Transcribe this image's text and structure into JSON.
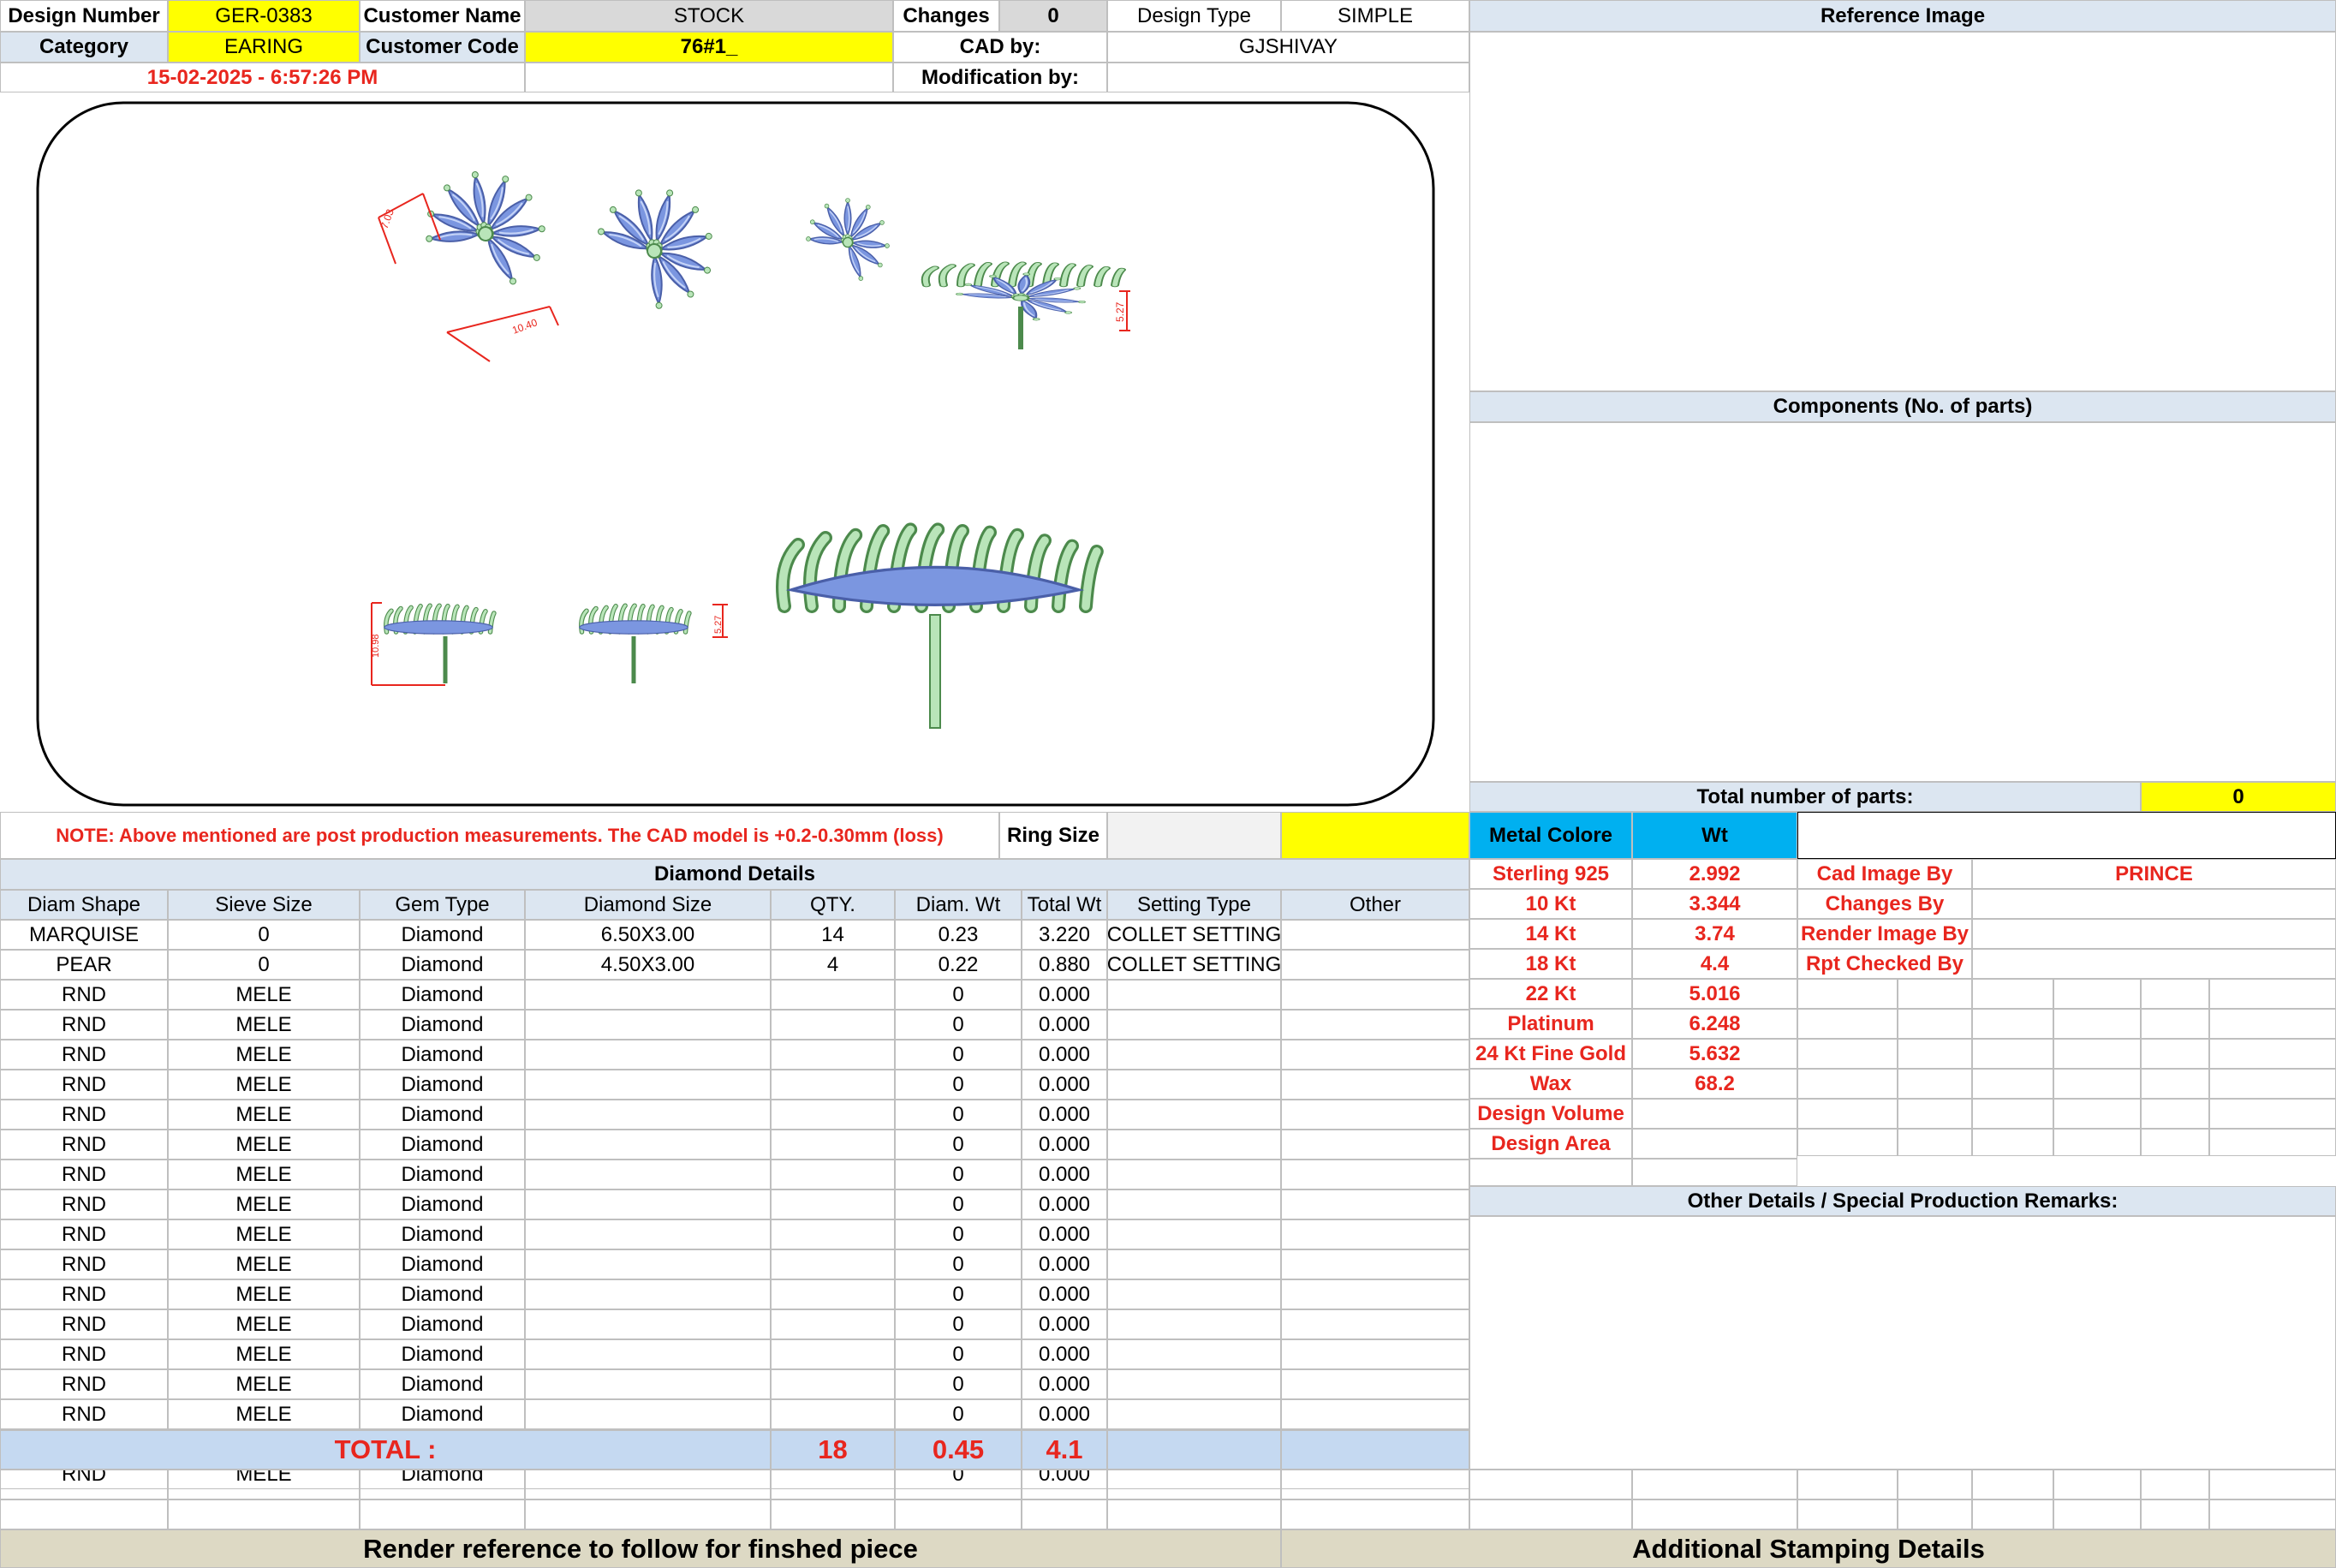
{
  "header": {
    "design_number_label": "Design Number",
    "design_number": "GER-0383",
    "customer_name_label": "Customer Name",
    "customer_name": "STOCK",
    "changes_label": "Changes",
    "changes": "0",
    "design_type_label": "Design Type",
    "design_type": "SIMPLE",
    "reference_image_label": "Reference Image",
    "category_label": "Category",
    "category": "EARING",
    "customer_code_label": "Customer Code",
    "customer_code": "76#1_",
    "cad_by_label": "CAD by:",
    "cad_by": "GJSHIVAY",
    "timestamp": "15-02-2025 - 6:57:26 PM",
    "modification_by_label": "Modification by:"
  },
  "drawing": {
    "dims": [
      "7.03",
      "10.40",
      "5.27",
      "10.98",
      "5.27"
    ]
  },
  "components": {
    "title": "Components (No. of parts)",
    "total_parts_label": "Total number of parts:",
    "total_parts": "0"
  },
  "note": "NOTE: Above mentioned are post production measurements. The CAD model is +0.2-0.30mm (loss)",
  "ring_size_label": "Ring Size",
  "metal": {
    "header": [
      "Metal Colore",
      "Wt"
    ],
    "rows": [
      [
        "Sterling 925",
        "2.992"
      ],
      [
        "10 Kt",
        "3.344"
      ],
      [
        "14 Kt",
        "3.74"
      ],
      [
        "18 Kt",
        "4.4"
      ],
      [
        "22 Kt",
        "5.016"
      ],
      [
        "Platinum",
        "6.248"
      ],
      [
        "24 Kt Fine Gold",
        "5.632"
      ],
      [
        "Wax",
        "68.2"
      ],
      [
        "Design Volume",
        ""
      ],
      [
        "Design Area",
        ""
      ]
    ]
  },
  "credits": [
    {
      "label": "Cad Image By",
      "value": "PRINCE"
    },
    {
      "label": "Changes By",
      "value": ""
    },
    {
      "label": "Render Image By",
      "value": ""
    },
    {
      "label": "Rpt Checked By",
      "value": ""
    }
  ],
  "other_details_title": "Other Details / Special Production Remarks:",
  "diamond": {
    "title": "Diamond Details",
    "columns": [
      "Diam Shape",
      "Sieve Size",
      "Gem Type",
      "Diamond Size",
      "QTY.",
      "Diam. Wt",
      "Total Wt",
      "Setting Type",
      "Other"
    ],
    "rows": [
      [
        "MARQUISE",
        "0",
        "Diamond",
        "6.50X3.00",
        "14",
        "0.23",
        "3.220",
        "COLLET SETTING",
        ""
      ],
      [
        "PEAR",
        "0",
        "Diamond",
        "4.50X3.00",
        "4",
        "0.22",
        "0.880",
        "COLLET SETTING",
        ""
      ],
      [
        "RND",
        "MELE",
        "Diamond",
        "",
        "",
        "0",
        "0.000",
        "",
        ""
      ],
      [
        "RND",
        "MELE",
        "Diamond",
        "",
        "",
        "0",
        "0.000",
        "",
        ""
      ],
      [
        "RND",
        "MELE",
        "Diamond",
        "",
        "",
        "0",
        "0.000",
        "",
        ""
      ],
      [
        "RND",
        "MELE",
        "Diamond",
        "",
        "",
        "0",
        "0.000",
        "",
        ""
      ],
      [
        "RND",
        "MELE",
        "Diamond",
        "",
        "",
        "0",
        "0.000",
        "",
        ""
      ],
      [
        "RND",
        "MELE",
        "Diamond",
        "",
        "",
        "0",
        "0.000",
        "",
        ""
      ],
      [
        "RND",
        "MELE",
        "Diamond",
        "",
        "",
        "0",
        "0.000",
        "",
        ""
      ],
      [
        "RND",
        "MELE",
        "Diamond",
        "",
        "",
        "0",
        "0.000",
        "",
        ""
      ],
      [
        "RND",
        "MELE",
        "Diamond",
        "",
        "",
        "0",
        "0.000",
        "",
        ""
      ],
      [
        "RND",
        "MELE",
        "Diamond",
        "",
        "",
        "0",
        "0.000",
        "",
        ""
      ],
      [
        "RND",
        "MELE",
        "Diamond",
        "",
        "",
        "0",
        "0.000",
        "",
        ""
      ],
      [
        "RND",
        "MELE",
        "Diamond",
        "",
        "",
        "0",
        "0.000",
        "",
        ""
      ],
      [
        "RND",
        "MELE",
        "Diamond",
        "",
        "",
        "0",
        "0.000",
        "",
        ""
      ],
      [
        "RND",
        "MELE",
        "Diamond",
        "",
        "",
        "0",
        "0.000",
        "",
        ""
      ],
      [
        "RND",
        "MELE",
        "Diamond",
        "",
        "",
        "0",
        "0.000",
        "",
        ""
      ],
      [
        "RND",
        "MELE",
        "Diamond",
        "",
        "",
        "0",
        "0.000",
        "",
        ""
      ],
      [
        "RND",
        "MELE",
        "Diamond",
        "",
        "",
        "0",
        "0.000",
        "",
        ""
      ]
    ],
    "total_label": "TOTAL :",
    "total_qty": "18",
    "total_diam_wt": "0.45",
    "total_wt": "4.1"
  },
  "footer": {
    "render_reference": "Render reference to follow for finshed piece",
    "stamping": "Additional Stamping Details"
  },
  "colors": {
    "highlight_yellow": "#ffff00",
    "header_blue": "#dce6f1",
    "total_blue": "#c5d9f1",
    "metal_header_cyan": "#00b0f0",
    "red_text": "#e8261e",
    "footer_tan": "#ddd9c4",
    "stone_blue": "#7b96e0",
    "metal_green": "#b9e5b9"
  }
}
